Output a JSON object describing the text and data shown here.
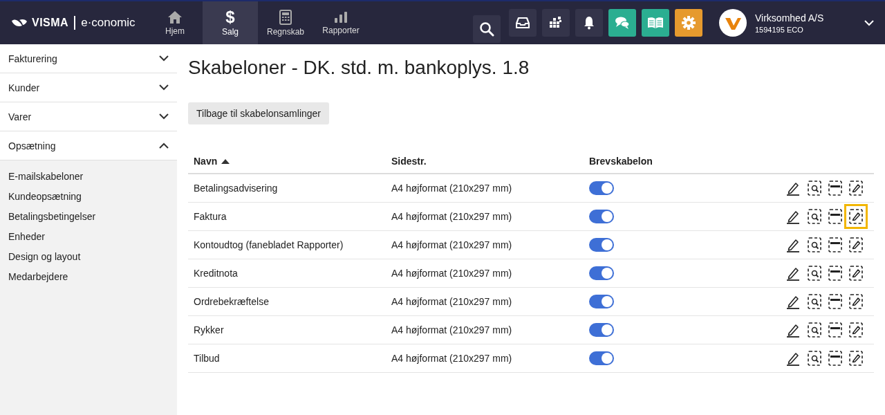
{
  "topbar": {
    "logo_brand": "VISMA",
    "logo_product": "e·conomic",
    "nav": [
      {
        "label": "Hjem",
        "selected": false
      },
      {
        "label": "Salg",
        "glyph": "$",
        "selected": true
      },
      {
        "label": "Regnskab",
        "selected": false
      },
      {
        "label": "Rapporter",
        "selected": false
      }
    ],
    "account": {
      "name": "Virksomhed A/S",
      "number": "1594195 ECO"
    }
  },
  "sidebar": {
    "sections": [
      {
        "label": "Fakturering",
        "expanded": false
      },
      {
        "label": "Kunder",
        "expanded": false
      },
      {
        "label": "Varer",
        "expanded": false
      },
      {
        "label": "Opsætning",
        "expanded": true,
        "items": [
          "E-mailskabeloner",
          "Kundeopsætning",
          "Betalingsbetingelser",
          "Enheder",
          "Design og layout",
          "Medarbejdere"
        ]
      }
    ]
  },
  "page": {
    "title": "Skabeloner - DK. std. m. bankoplys. 1.8",
    "back_button": "Tilbage til skabelonsamlinger"
  },
  "table": {
    "columns": [
      {
        "label": "Navn",
        "sorted": true
      },
      {
        "label": "Sidestr.",
        "sorted": false
      },
      {
        "label": "Brevskabelon",
        "sorted": false
      }
    ],
    "rows": [
      {
        "name": "Betalingsadvisering",
        "size": "A4 højformat (210x297 mm)",
        "on": true,
        "focused": false
      },
      {
        "name": "Faktura",
        "size": "A4 højformat (210x297 mm)",
        "on": true,
        "focused": true
      },
      {
        "name": "Kontoudtog (fanebladet Rapporter)",
        "size": "A4 højformat (210x297 mm)",
        "on": true,
        "focused": false
      },
      {
        "name": "Kreditnota",
        "size": "A4 højformat (210x297 mm)",
        "on": true,
        "focused": false
      },
      {
        "name": "Ordrebekræftelse",
        "size": "A4 højformat (210x297 mm)",
        "on": true,
        "focused": false
      },
      {
        "name": "Rykker",
        "size": "A4 højformat (210x297 mm)",
        "on": true,
        "focused": false
      },
      {
        "name": "Tilbud",
        "size": "A4 højformat (210x297 mm)",
        "on": true,
        "focused": false
      }
    ]
  }
}
